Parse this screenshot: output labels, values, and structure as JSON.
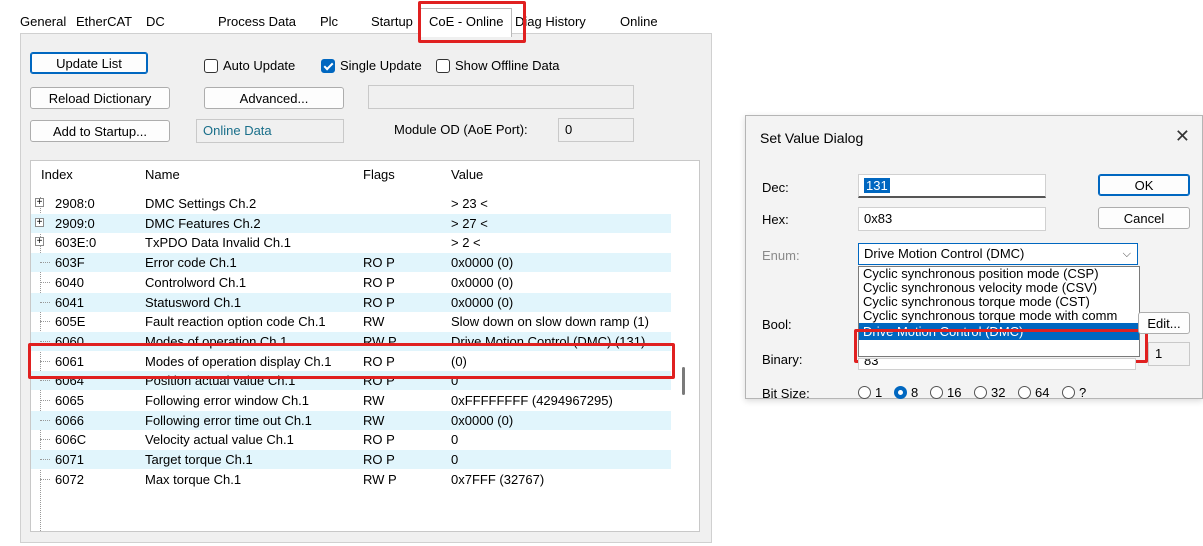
{
  "tabs": [
    {
      "label": "General"
    },
    {
      "label": "EtherCAT"
    },
    {
      "label": "DC"
    },
    {
      "label": "Process Data"
    },
    {
      "label": "Plc"
    },
    {
      "label": "Startup"
    },
    {
      "label": "CoE - Online",
      "active": true
    },
    {
      "label": "Diag History"
    },
    {
      "label": "Online"
    }
  ],
  "toolbar": {
    "update_list": "Update List",
    "auto_update": "Auto Update",
    "single_update": "Single Update",
    "show_offline": "Show Offline Data",
    "reload_dictionary": "Reload Dictionary",
    "advanced": "Advanced...",
    "add_to_startup": "Add to Startup...",
    "online_data": "Online Data",
    "module_od_label": "Module OD (AoE Port):",
    "module_od_value": "0",
    "single_update_checked": true,
    "auto_update_checked": false,
    "show_offline_checked": false
  },
  "table": {
    "headers": {
      "index": "Index",
      "name": "Name",
      "flags": "Flags",
      "value": "Value"
    },
    "rows": [
      {
        "index": "2908:0",
        "name": "DMC Settings Ch.2",
        "flags": "",
        "value": "> 23 <",
        "expandable": true
      },
      {
        "index": "2909:0",
        "name": "DMC Features Ch.2",
        "flags": "",
        "value": "> 27 <",
        "expandable": true
      },
      {
        "index": "603E:0",
        "name": "TxPDO Data Invalid Ch.1",
        "flags": "",
        "value": "> 2 <",
        "expandable": true
      },
      {
        "index": "603F",
        "name": "Error code Ch.1",
        "flags": "RO P",
        "value": "0x0000 (0)"
      },
      {
        "index": "6040",
        "name": "Controlword Ch.1",
        "flags": "RO P",
        "value": "0x0000 (0)"
      },
      {
        "index": "6041",
        "name": "Statusword Ch.1",
        "flags": "RO P",
        "value": "0x0000 (0)"
      },
      {
        "index": "605E",
        "name": "Fault reaction option code Ch.1",
        "flags": "RW",
        "value": "Slow down on slow down ramp (1)"
      },
      {
        "index": "6060",
        "name": "Modes of operation Ch.1",
        "flags": "RW P",
        "value": "Drive Motion Control (DMC) (131)"
      },
      {
        "index": "6061",
        "name": "Modes of operation display Ch.1",
        "flags": "RO P",
        "value": "(0)"
      },
      {
        "index": "6064",
        "name": "Position actual value Ch.1",
        "flags": "RO P",
        "value": "0"
      },
      {
        "index": "6065",
        "name": "Following error window Ch.1",
        "flags": "RW",
        "value": "0xFFFFFFFF (4294967295)"
      },
      {
        "index": "6066",
        "name": "Following error time out Ch.1",
        "flags": "RW",
        "value": "0x0000 (0)"
      },
      {
        "index": "606C",
        "name": "Velocity actual value Ch.1",
        "flags": "RO P",
        "value": "0"
      },
      {
        "index": "6071",
        "name": "Target torque Ch.1",
        "flags": "RO P",
        "value": "0"
      },
      {
        "index": "6072",
        "name": "Max torque Ch.1",
        "flags": "RW P",
        "value": "0x7FFF (32767)"
      }
    ]
  },
  "dialog": {
    "title": "Set Value Dialog",
    "dec_label": "Dec:",
    "dec_value": "131",
    "hex_label": "Hex:",
    "hex_value": "0x83",
    "enum_label": "Enum:",
    "enum_value": "Drive Motion Control (DMC)",
    "enum_options": [
      "Cyclic synchronous position mode (CSP)",
      "Cyclic synchronous velocity mode (CSV)",
      "Cyclic synchronous torque mode (CST)",
      "Cyclic synchronous torque mode with comm",
      "Drive Motion Control (DMC)"
    ],
    "bool_label": "Bool:",
    "edit_label": "Edit...",
    "binary_label": "Binary:",
    "binary_value": "83",
    "binary_size": "1",
    "bitsize_label": "Bit Size:",
    "bitsizes": [
      "1",
      "8",
      "16",
      "32",
      "64",
      "?"
    ],
    "bitsize_selected": "8",
    "ok": "OK",
    "cancel": "Cancel"
  },
  "colors": {
    "highlight": "#e02020",
    "accent": "#0067c0",
    "row_alt": "#e1f5fc"
  }
}
